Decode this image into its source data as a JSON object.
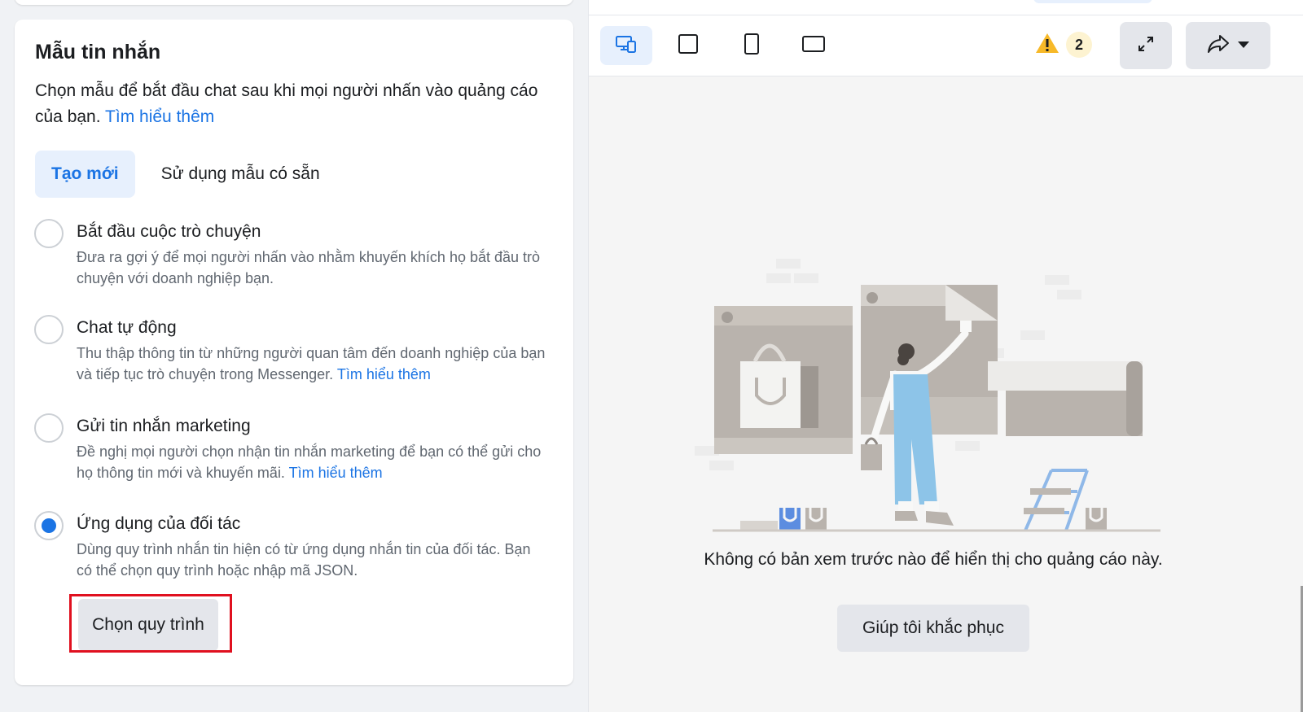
{
  "template_panel": {
    "title": "Mẫu tin nhắn",
    "description": "Chọn mẫu để bắt đầu chat sau khi mọi người nhấn vào quảng cáo của bạn.",
    "learn_more": "Tìm hiểu thêm",
    "tabs": [
      {
        "label": "Tạo mới",
        "active": true
      },
      {
        "label": "Sử dụng mẫu có sẵn",
        "active": false
      }
    ],
    "options": [
      {
        "title": "Bắt đầu cuộc trò chuyện",
        "description": "Đưa ra gợi ý để mọi người nhấn vào nhằm khuyến khích họ bắt đầu trò chuyện với doanh nghiệp bạn.",
        "link": "",
        "selected": false
      },
      {
        "title": "Chat tự động",
        "description": "Thu thập thông tin từ những người quan tâm đến doanh nghiệp của bạn và tiếp tục trò chuyện trong Messenger.",
        "link": "Tìm hiểu thêm",
        "selected": false
      },
      {
        "title": "Gửi tin nhắn marketing",
        "description": "Đề nghị mọi người chọn nhận tin nhắn marketing để bạn có thể gửi cho họ thông tin mới và khuyến mãi.",
        "link": "Tìm hiểu thêm",
        "selected": false
      },
      {
        "title": "Ứng dụng của đối tác",
        "description": "Dùng quy trình nhắn tin hiện có từ ứng dụng nhắn tin của đối tác. Bạn có thể chọn quy trình hoặc nhập mã JSON.",
        "link": "",
        "selected": true
      }
    ],
    "choose_flow_button": "Chọn quy trình"
  },
  "preview_panel": {
    "toolbar": {
      "device_buttons": [
        "devices-icon",
        "square-icon",
        "portrait-icon",
        "landscape-icon"
      ],
      "active_device": "devices-icon",
      "warning_count": "2",
      "expand_icon": "expand-icon",
      "share_icon": "share-icon",
      "dropdown_icon": "caret-down-icon"
    },
    "empty_message": "Không có bản xem trước nào để hiển thị cho quảng cáo này.",
    "fix_button": "Giúp tôi khắc phục"
  },
  "colors": {
    "accent": "#1b74e4",
    "accent_bg": "#e7f0fd",
    "warning": "#f7b928",
    "highlight_border": "#e0101f"
  }
}
